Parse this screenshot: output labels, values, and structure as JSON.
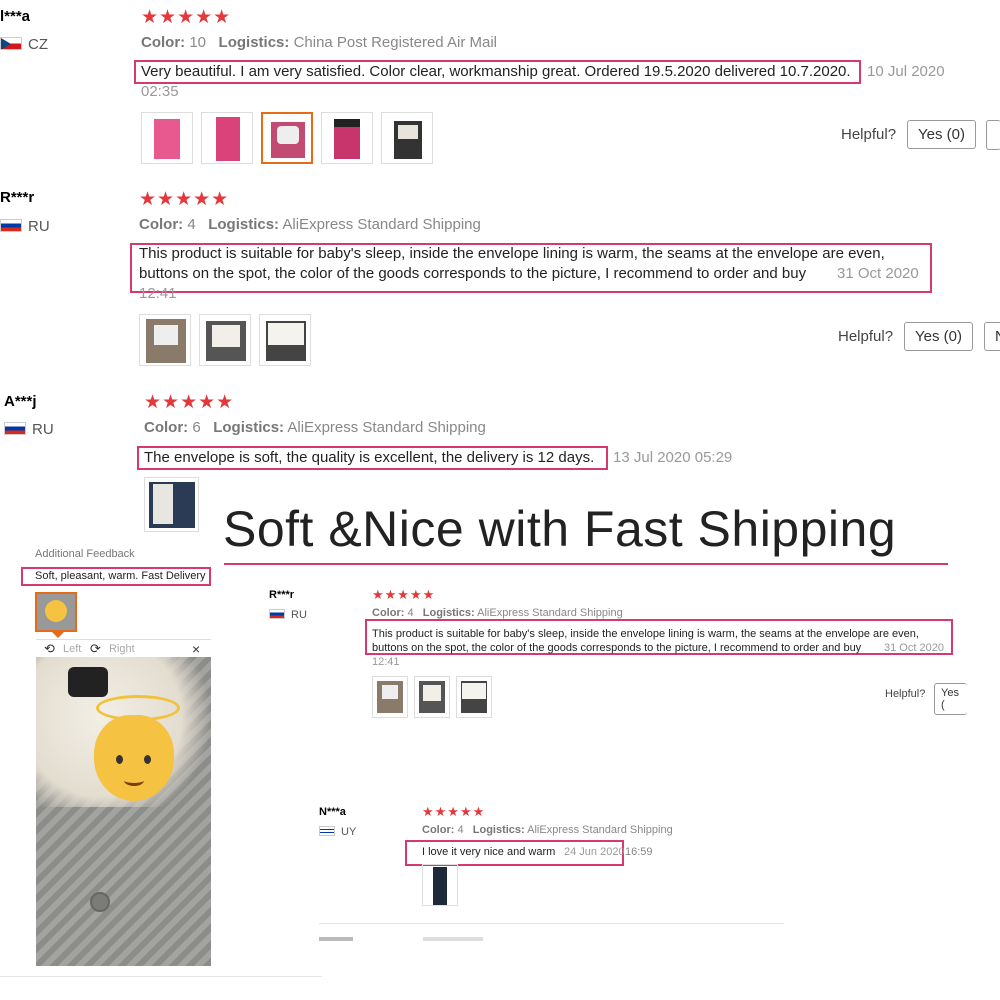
{
  "reviews_top": [
    {
      "name": "l***a",
      "country": "CZ",
      "stars": "★★★★★",
      "color_label": "Color:",
      "color_value": "10",
      "logistics_label": "Logistics:",
      "logistics_value": "China Post Registered Air Mail",
      "text": "Very beautiful. I am very satisfied. Color clear, workmanship great. Ordered 19.5.2020 delivered 10.7.2020.",
      "date": "10 Jul 2020",
      "time": "02:35",
      "helpful": "Helpful?",
      "yes": "Yes (0)"
    },
    {
      "name": "R***r",
      "country": "RU",
      "stars": "★★★★★",
      "color_label": "Color:",
      "color_value": "4",
      "logistics_label": "Logistics:",
      "logistics_value": "AliExpress Standard Shipping",
      "text_line1": "This product is suitable for baby's sleep, inside the envelope lining is warm, the seams at the envelope are even,",
      "text_line2": "buttons on the spot, the color of the goods corresponds to the picture, I recommend to order and buy",
      "date": "31 Oct 2020",
      "time": "12:41",
      "helpful": "Helpful?",
      "yes": "Yes (0)",
      "no_partial": "N"
    },
    {
      "name": "A***j",
      "country": "RU",
      "stars": "★★★★★",
      "color_label": "Color:",
      "color_value": "6",
      "logistics_label": "Logistics:",
      "logistics_value": "AliExpress Standard Shipping",
      "text": "The envelope is soft, the quality is excellent, the delivery is 12 days.",
      "date": "13 Jul 2020 05:29"
    }
  ],
  "title": "Soft &Nice with Fast Shipping",
  "feedback": {
    "heading": "Additional Feedback",
    "text": "Soft, pleasant, warm. Fast Delivery",
    "left": "Left",
    "right": "Right",
    "close": "×"
  },
  "reviews_small": [
    {
      "name": "R***r",
      "country": "RU",
      "stars": "★★★★★",
      "color_label": "Color:",
      "color_value": "4",
      "logistics_label": "Logistics:",
      "logistics_value": "AliExpress Standard Shipping",
      "text_line1": "This product is suitable for baby's sleep, inside the envelope lining is warm, the seams at the envelope are even,",
      "text_line2": "buttons on the spot, the color of the goods corresponds to the picture, I recommend to order and buy",
      "date": "31 Oct 2020",
      "time": "12:41",
      "helpful": "Helpful?",
      "yes": "Yes ("
    },
    {
      "name": "N***a",
      "country": "UY",
      "stars": "★★★★★",
      "color_label": "Color:",
      "color_value": "4",
      "logistics_label": "Logistics:",
      "logistics_value": "AliExpress Standard Shipping",
      "text": "I love it very nice and warm",
      "date": "24 Jun 2020",
      "time": "16:59"
    }
  ],
  "colors": {
    "accent": "#e4393c",
    "highlight": "#d63a6c",
    "selected": "#e56a1a"
  },
  "icons": [
    "rotate-left-icon",
    "rotate-right-icon",
    "close-icon",
    "baby-emoji"
  ]
}
